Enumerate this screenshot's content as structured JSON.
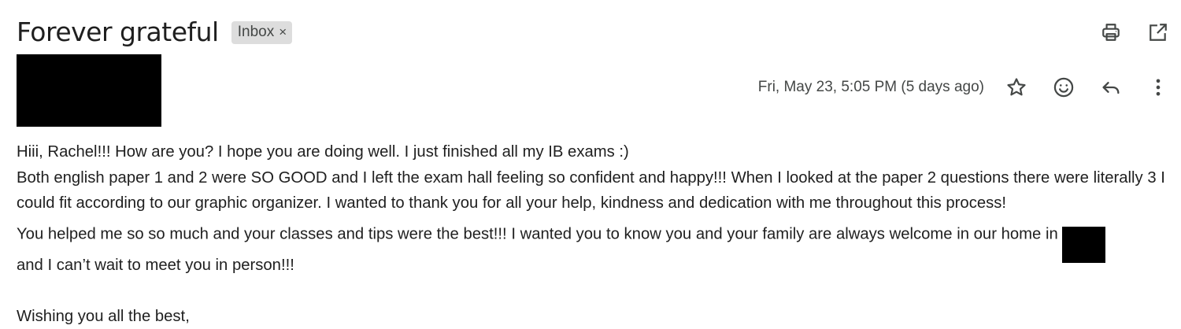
{
  "email": {
    "subject": "Forever grateful",
    "label_chip": {
      "label": "Inbox",
      "close_glyph": "×"
    },
    "header_actions": [
      {
        "name": "print-all-icon"
      },
      {
        "name": "open-in-new-window-icon"
      }
    ],
    "date_text": "Fri, May 23, 5:05 PM (5 days ago)",
    "message_actions": [
      {
        "name": "star-icon"
      },
      {
        "name": "add-reaction-icon"
      },
      {
        "name": "reply-icon"
      },
      {
        "name": "more-options-icon"
      }
    ],
    "body": {
      "line1": "Hiii, Rachel!!! How are you? I hope you are doing well. I just finished all my IB exams :)",
      "paragraph2": "Both english paper 1 and 2 were SO GOOD and I left the exam hall feeling so confident and happy!!! When I looked at the paper 2 questions there were literally 3 I could fit according to our graphic organizer. I wanted to thank you for all your help, kindness and dedication with me throughout this process!",
      "line4": "You helped me so so much and your classes and tips were the best!!! I wanted you to know you and your family are always welcome in our home in",
      "line5": "and I can’t wait to meet you in person!!!",
      "signoff": "Wishing you all the best,"
    }
  }
}
